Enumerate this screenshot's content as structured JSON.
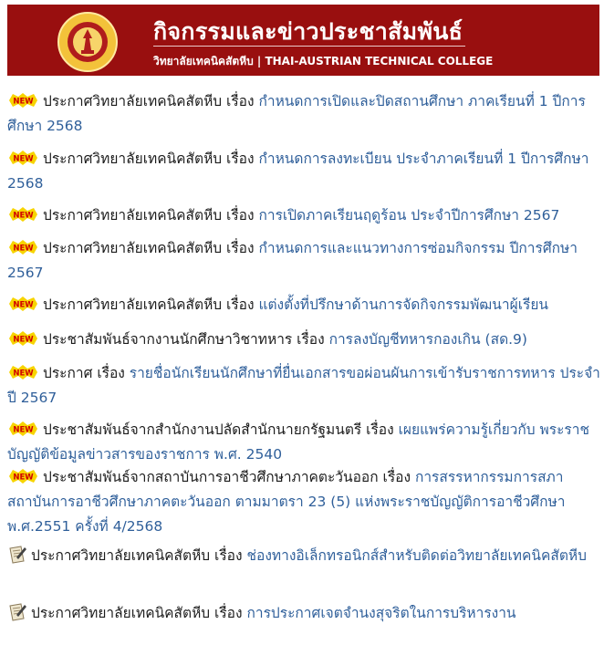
{
  "header": {
    "title": "กิจกรรมและข่าวประชาสัมพันธ์",
    "subtitle": "วิทยาลัยเทคนิคสัตหีบ | THAI-AUSTRIAN TECHNICAL COLLEGE",
    "background_color": "#990f0f",
    "logo": "college-seal-logo"
  },
  "colors": {
    "link": "#2f5f9a",
    "text": "#1c1c1c",
    "new_badge_bg": "#f7d400",
    "new_badge_text": "#d00000"
  },
  "news_items": [
    {
      "icon": "new-badge-icon",
      "badge": "NEW",
      "prefix": "ประกาศวิทยาลัยเทคนิคสัตหีบ เรื่อง ",
      "link_text": "กำหนดการเปิดและปิดสถานศึกษา ภาคเรียนที่ 1 ปีการศึกษา 2568"
    },
    {
      "icon": "new-badge-icon",
      "badge": "NEW",
      "prefix": "ประกาศวิทยาลัยเทคนิคสัตหีบ เรื่อง ",
      "link_text": "กำหนดการลงทะเบียน ประจำภาคเรียนที่ 1 ปีการศึกษา 2568"
    },
    {
      "icon": "new-badge-icon",
      "badge": "NEW",
      "prefix": "ประกาศวิทยาลัยเทคนิคสัตหีบ เรื่อง ",
      "link_text": "การเปิดภาคเรียนฤดูร้อน ประจำปีการศึกษา 2567"
    },
    {
      "icon": "new-badge-icon",
      "badge": "NEW",
      "prefix": "ประกาศวิทยาลัยเทคนิคสัตหีบ เรื่อง ",
      "link_text": "กำหนดการและแนวทางการซ่อมกิจกรรม ปีการศึกษา 2567"
    },
    {
      "icon": "new-badge-icon",
      "badge": "NEW",
      "prefix": "ประกาศวิทยาลัยเทคนิคสัตหีบ เรื่อง ",
      "link_text": "แต่งตั้งที่ปรึกษาด้านการจัดกิจกรรมพัฒนาผู้เรียน"
    },
    {
      "icon": "new-badge-icon",
      "badge": "NEW",
      "prefix": "ประชาสัมพันธ์จากงานนักศึกษาวิชาทหาร เรื่อง ",
      "link_text": "การลงบัญชีทหารกองเกิน (สด.9)"
    },
    {
      "icon": "new-badge-icon",
      "badge": "NEW",
      "prefix": "ประกาศ เรื่อง ",
      "link_text": "รายชื่อนักเรียนนักศึกษาที่ยื่นเอกสารขอผ่อนผันการเข้ารับราชการทหาร ประจำปี 2567"
    },
    {
      "icon": "new-badge-icon",
      "badge": "NEW",
      "prefix": "ประชาสัมพันธ์จากสำนักงานปลัดสำนักนายกรัฐมนตรี เรื่อง ",
      "link_text": "เผยแพร่ความรู้เกี่ยวกับ พระราชบัญญัติข้อมูลข่าวสารของราชการ พ.ศ. 2540"
    },
    {
      "icon": "new-badge-icon",
      "badge": "NEW",
      "prefix": "ประชาสัมพันธ์จากสถาบันการอาชีวศึกษาภาคตะวันออก เรื่อง ",
      "link_text": "การสรรหากรรมการสภาสถาบันการอาชีวศึกษาภาคตะวันออก ตามมาตรา 23 (5) แห่งพระราชบัญญัติการอาชีวศึกษา พ.ศ.2551 ครั้งที่ 4/2568"
    },
    {
      "icon": "document-pen-icon",
      "badge": "",
      "prefix": "ประกาศวิทยาลัยเทคนิคสัตหีบ เรื่อง ",
      "link_text": "ช่องทางอิเล็กทรอนิกส์สำหรับติดต่อวิทยาลัยเทคนิคสัตหีบ"
    },
    {
      "icon": "document-pen-icon",
      "badge": "",
      "prefix": "ประกาศวิทยาลัยเทคนิคสัตหีบ เรื่อง ",
      "link_text": "การประกาศเจตจำนงสุจริตในการบริหารงาน"
    }
  ]
}
